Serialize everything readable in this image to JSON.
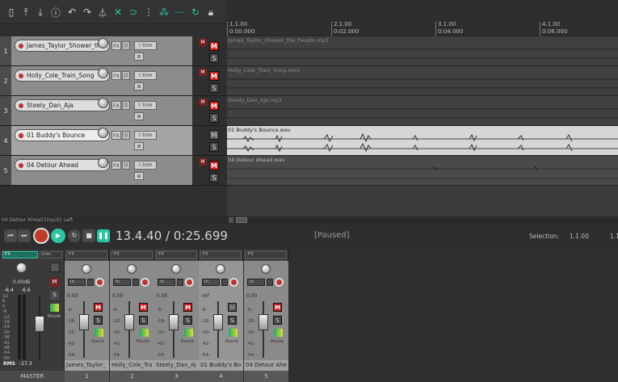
{
  "toolbar": {
    "icons": [
      "new-project-icon",
      "open-project-icon",
      "save-icon",
      "project-settings-icon",
      "undo-icon",
      "redo-icon",
      "metronome-icon",
      "ripple-icon",
      "snap-icon",
      "item-grouping-icon",
      "auto-crossfade-icon",
      "grid-icon",
      "loop-icon",
      "lock-icon"
    ]
  },
  "ruler": {
    "marks": [
      {
        "bar": "1.1.00",
        "time": "0:00.000"
      },
      {
        "bar": "2.1.00",
        "time": "0:02.000"
      },
      {
        "bar": "3.1.00",
        "time": "0:04.000"
      },
      {
        "bar": "4.1.00",
        "time": "0:06.000"
      }
    ]
  },
  "tracks": [
    {
      "num": "1",
      "name": "James_Taylor_Shower_th",
      "item": "James_Taylor_Shower_the_People.mp3",
      "muted": true,
      "selected": false
    },
    {
      "num": "2",
      "name": "Holly_Cole_Train_Song",
      "item": "Holly_Cole_Train_Song.mp3",
      "muted": true,
      "selected": false
    },
    {
      "num": "3",
      "name": "Steely_Dan_Aja",
      "item": "Steely_Dan_Aja.mp3",
      "muted": true,
      "selected": false
    },
    {
      "num": "4",
      "name": "01  Buddy's Bounce",
      "item": "01  Buddy's Bounce.wav",
      "muted": false,
      "selected": true
    },
    {
      "num": "5",
      "name": "04 Detour Ahead",
      "item": "04 Detour Ahead.wav",
      "muted": true,
      "selected": false
    }
  ],
  "labels": {
    "fx": "FX",
    "trim": "trim",
    "mute": "M",
    "solo": "S",
    "in": "in",
    "route": "Route",
    "master": "MASTER"
  },
  "status_input": "04 Detour Ahead [input]: Left",
  "transport": {
    "timecode": "13.4.40 / 0:25.699",
    "state": "[Paused]",
    "selection_label": "Selection:",
    "selection_start": "1.1.00",
    "selection_end": "1.1"
  },
  "master": {
    "vol": "0.00dB",
    "peak_l": "-6.4",
    "peak_r": "-6.6",
    "rms_label": "RMS",
    "rms_value": "-17.3",
    "scale": [
      "12",
      "6",
      "0",
      "-6",
      "-12",
      "-18",
      "-24",
      "-30",
      "-36",
      "-42",
      "-48",
      "-54",
      "-60"
    ],
    "fx": "FX",
    "trim": "trim"
  },
  "strips": [
    {
      "num": "1",
      "name": "James_Taylor_",
      "vol": "0.00",
      "fx": "FX"
    },
    {
      "num": "2",
      "name": "Holly_Cole_Tra",
      "vol": "0.00",
      "fx": "FX"
    },
    {
      "num": "3",
      "name": "Steely_Dan_Aj",
      "vol": "0.00",
      "fx": "FX"
    },
    {
      "num": "4",
      "name": "01  Buddy's Bo",
      "vol": "-inf",
      "fx": "FX"
    },
    {
      "num": "5",
      "name": "04 Detour Ahe",
      "vol": "0.00",
      "fx": "FX"
    }
  ],
  "strip_scale": [
    "-6-",
    "-18-",
    "-30-",
    "-42-",
    "-54-"
  ],
  "colors": {
    "accent": "#33c1a6",
    "mute_red": "#c82020",
    "play_green": "#2ec4a0"
  }
}
